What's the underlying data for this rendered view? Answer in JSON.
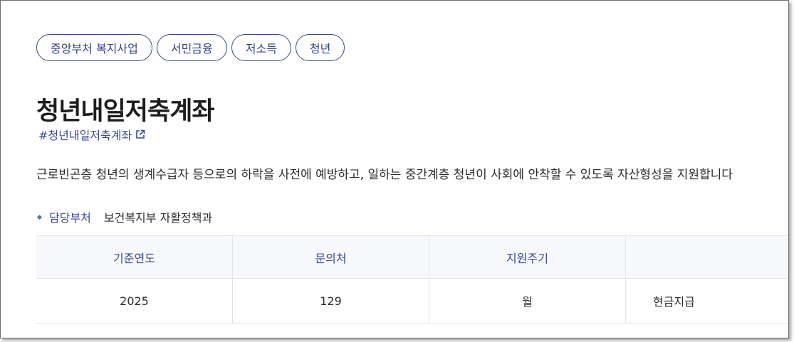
{
  "tags": [
    "중앙부처 복지사업",
    "서민금융",
    "저소득",
    "청년"
  ],
  "title": "청년내일저축계좌",
  "hashtag": "#청년내일저축계좌",
  "description": "근로빈곤층 청년의 생계수급자 등으로의 하락을 사전에 예방하고, 일하는 중간계층 청년이 사회에 안착할 수 있도록 자산형성을 지원합니다",
  "department": {
    "label": "담당부처",
    "value": "보건복지부 자활정책과"
  },
  "info_table": {
    "headers": [
      "기준연도",
      "문의처",
      "지원주기",
      ""
    ],
    "row": [
      "2025",
      "129",
      "월",
      "현금지급"
    ]
  },
  "colors": {
    "accent": "#3a4a95",
    "header_bg": "#f7f8fb",
    "border": "#e3e3e3"
  },
  "icons": {
    "hashtag_link": "external-link-icon",
    "department_bullet": "diamond-bullet-icon"
  }
}
